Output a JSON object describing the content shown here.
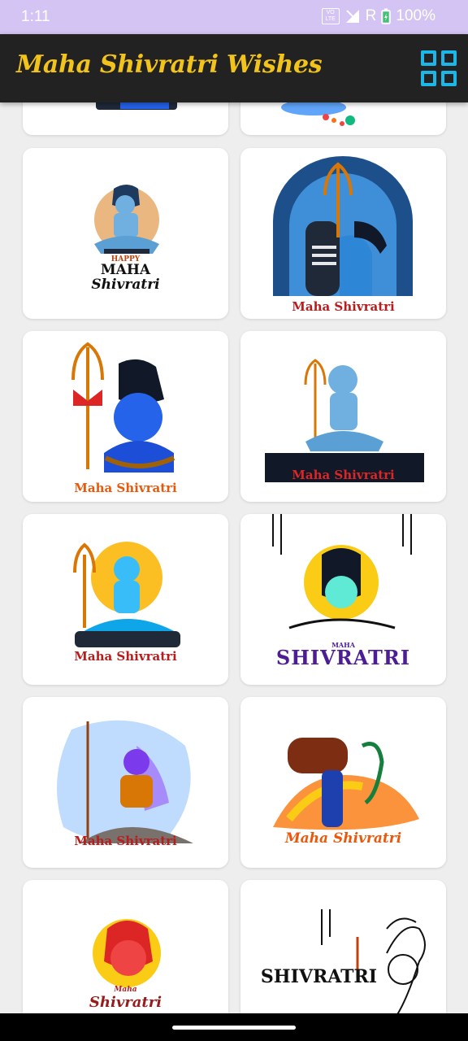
{
  "status_bar": {
    "time": "1:11",
    "volte_top": "VO",
    "volte_bottom": "LTE",
    "roaming": "R",
    "battery": "100%"
  },
  "app_bar": {
    "title": "Maha Shivratri Wishes",
    "grid_icon": "grid-view-icon",
    "title_color": "#f2c31a",
    "icon_color": "#1ab7e8"
  },
  "cards": [
    {
      "caption": ""
    },
    {
      "caption": ""
    },
    {
      "caption_top": "HAPPY",
      "caption_mid": "MAHA",
      "caption": "Shivratri"
    },
    {
      "caption": "Maha Shivratri"
    },
    {
      "caption": "Maha Shivratri"
    },
    {
      "caption": "Maha Shivratri"
    },
    {
      "caption": "Maha Shivratri"
    },
    {
      "caption_top": "MAHA",
      "caption": "SHIVRATRI"
    },
    {
      "caption": "Maha Shivratri"
    },
    {
      "caption": "Maha Shivratri"
    },
    {
      "caption_top": "Maha",
      "caption": "Shivratri"
    },
    {
      "caption": "SHIVRATRI"
    }
  ]
}
